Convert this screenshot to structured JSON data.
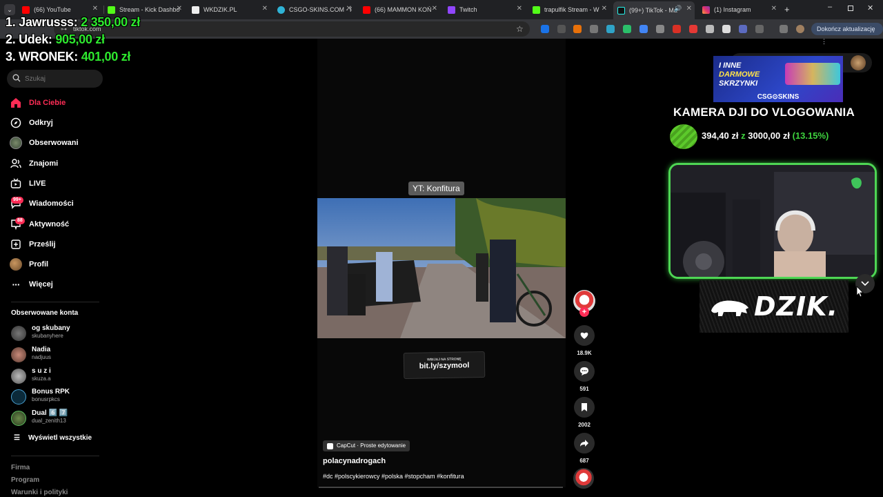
{
  "tabs": [
    {
      "title": "(66) YouTube",
      "icon": "youtube-icon"
    },
    {
      "title": "Stream - Kick Dashbo",
      "icon": "kick-icon"
    },
    {
      "title": "WKDZIK.PL",
      "icon": "wkdzik-icon"
    },
    {
      "title": "CSGO-SKINS.COM - F",
      "icon": "csgo-skins-icon"
    },
    {
      "title": "(66) MAMMON KOŃ",
      "icon": "youtube-icon"
    },
    {
      "title": "Twitch",
      "icon": "twitch-icon"
    },
    {
      "title": "trapulfik Stream - W",
      "icon": "kick-icon"
    },
    {
      "title": "(99+) TikTok - Ma",
      "icon": "tiktok-icon"
    },
    {
      "title": "(1) Instagram",
      "icon": "instagram-icon"
    }
  ],
  "address": {
    "url": "tiktok.com"
  },
  "update_button": "Dokończ aktualizację",
  "leaderboard": [
    {
      "rank_name": "1. Jawrusss:",
      "amount": "2 350,00 zł"
    },
    {
      "rank_name": "2. Udek:",
      "amount": "905,00 zł"
    },
    {
      "rank_name": "3. WRONEK:",
      "amount": "401,00 zł"
    }
  ],
  "sidebar": {
    "search_placeholder": "Szukaj",
    "nav": [
      {
        "label": "Dla Ciebie",
        "icon": "home-icon",
        "active": true
      },
      {
        "label": "Odkryj",
        "icon": "compass-icon"
      },
      {
        "label": "Obserwowani",
        "icon": "following-avatar-icon"
      },
      {
        "label": "Znajomi",
        "icon": "friends-icon"
      },
      {
        "label": "LIVE",
        "icon": "live-tv-icon"
      },
      {
        "label": "Wiadomości",
        "icon": "messages-icon",
        "badge": "99+"
      },
      {
        "label": "Aktywność",
        "icon": "activity-icon",
        "badge": "88"
      },
      {
        "label": "Prześlij",
        "icon": "upload-icon"
      },
      {
        "label": "Profil",
        "icon": "profile-avatar-icon"
      },
      {
        "label": "Więcej",
        "icon": "more-icon"
      }
    ],
    "following_title": "Obserwowane konta",
    "accounts": [
      {
        "name": "og skubany",
        "handle": "skubanyhere"
      },
      {
        "name": "Nadia",
        "handle": "nadjuus"
      },
      {
        "name": "s u z i",
        "handle": "skuza.a"
      },
      {
        "name": "Bonus RPK",
        "handle": "bonusrpkcs"
      },
      {
        "name": "Dual 6️⃣ 7️⃣",
        "handle": "dual_zenith13"
      }
    ],
    "see_all": "Wyświetl wszystkie",
    "footer": [
      "Firma",
      "Program",
      "Warunki i polityki"
    ]
  },
  "video": {
    "overlay_tag": "YT: Konfitura",
    "sticker_small": "WBIJAJ NA STRONĘ",
    "sticker_link": "bit.ly/szymool",
    "capcut_label": "CapCut · Proste edytowanie",
    "author": "polacynadrogach",
    "hashtags": "#dc #polscykierowcy #polska #stopcham #konfitura"
  },
  "actions": {
    "likes": "18.9K",
    "comments": "591",
    "saves": "2002",
    "shares": "687"
  },
  "overlay": {
    "promo_line1": "I INNE",
    "promo_line2": "DARMOWE",
    "promo_line3": "SKRZYNKI",
    "promo_brand": "CSG⊙SKINS",
    "goal_title": "KAMERA DJI DO VLOGOWANIA",
    "goal_current": "394,40 zł",
    "goal_sep": "z",
    "goal_target": "3000,00 zł",
    "goal_percent": "(13.15%)",
    "banner": "DZIK."
  },
  "colors": {
    "tiktok_red": "#fe2c55",
    "goal_green": "#3ed43e",
    "cam_border": "#4ed654"
  }
}
